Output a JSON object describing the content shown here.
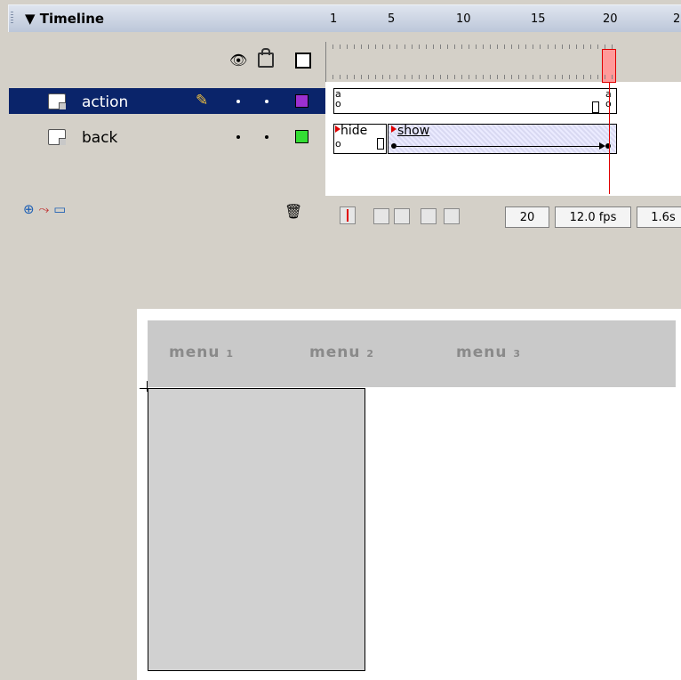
{
  "panel": {
    "title": "▼ Timeline"
  },
  "layers": [
    {
      "name": "action",
      "color": "#9b30d0",
      "selected": true
    },
    {
      "name": "back",
      "color": "#33dd33",
      "selected": false
    }
  ],
  "ruler": {
    "labels": [
      "1",
      "5",
      "10",
      "15",
      "20",
      "2"
    ]
  },
  "frame_labels": {
    "hide": "hide",
    "show": "show"
  },
  "action_marks": {
    "first": "a",
    "last": "a"
  },
  "status": {
    "current_frame": "20",
    "fps": "12.0 fps",
    "time": "1.6s"
  },
  "icons": {
    "eye": "eye-icon",
    "lock": "lock-icon",
    "outline": "outline-icon",
    "pencil": "pencil-icon",
    "trash": "trash-icon"
  },
  "stage": {
    "menus": [
      {
        "label": "menu",
        "num": "1"
      },
      {
        "label": "menu",
        "num": "2"
      },
      {
        "label": "menu",
        "num": "3"
      }
    ]
  }
}
